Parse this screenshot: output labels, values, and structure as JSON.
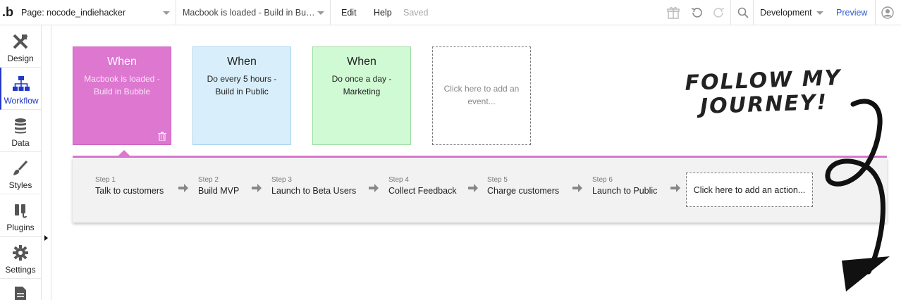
{
  "topbar": {
    "logo": ".b",
    "page_label": "Page: nocode_indiehacker",
    "workflow_label": "Macbook is loaded - Build in Bubble",
    "edit": "Edit",
    "help": "Help",
    "saved": "Saved",
    "environment": "Development",
    "preview": "Preview"
  },
  "sidebar": {
    "items": [
      {
        "label": "Design",
        "icon": "design-icon"
      },
      {
        "label": "Workflow",
        "icon": "workflow-icon"
      },
      {
        "label": "Data",
        "icon": "database-icon"
      },
      {
        "label": "Styles",
        "icon": "brush-icon"
      },
      {
        "label": "Plugins",
        "icon": "plug-icon"
      },
      {
        "label": "Settings",
        "icon": "gear-icon"
      },
      {
        "label": "",
        "icon": "document-icon"
      }
    ]
  },
  "events": [
    {
      "when": "When",
      "desc": "Macbook is loaded - Build in Bubble",
      "color": "#dd77d0"
    },
    {
      "when": "When",
      "desc": "Do every 5 hours - Build in Public",
      "color": "#d8effb"
    },
    {
      "when": "When",
      "desc": "Do once a day - Marketing",
      "color": "#d0fad3"
    },
    {
      "desc": "Click here to add an event..."
    }
  ],
  "steps": [
    {
      "num": "Step 1",
      "name": "Talk to customers"
    },
    {
      "num": "Step 2",
      "name": "Build MVP"
    },
    {
      "num": "Step 3",
      "name": "Launch to Beta Users"
    },
    {
      "num": "Step 4",
      "name": "Collect Feedback"
    },
    {
      "num": "Step 5",
      "name": "Charge customers"
    },
    {
      "num": "Step 6",
      "name": "Launch to Public"
    }
  ],
  "add_action": "Click here to add an action...",
  "annotation": {
    "line1": "FOLLOW MY",
    "line2": "JOURNEY!"
  },
  "colors": {
    "accent": "#2438c8",
    "preview_link": "#2f5bd9",
    "selected_event": "#dd77d0"
  }
}
